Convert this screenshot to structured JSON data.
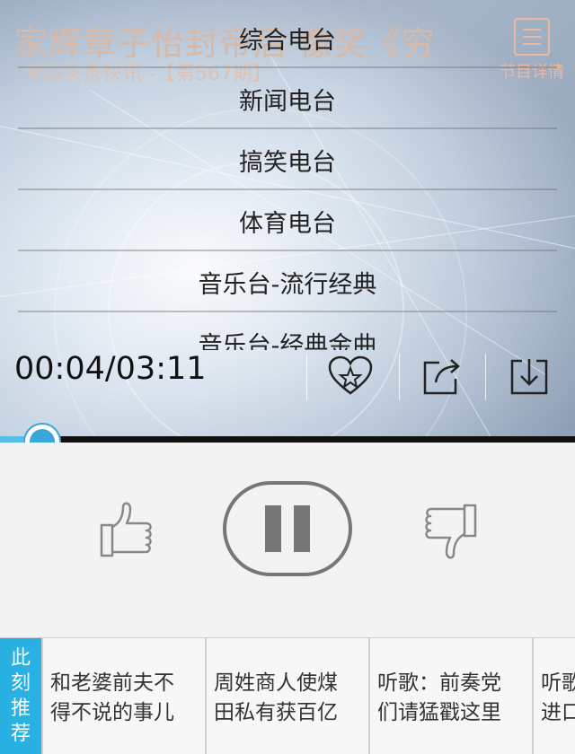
{
  "header": {
    "song_title": "家辉章子怡封帝后 像奖《穷",
    "song_subtitle": "考拉头条快讯 -【第567期】",
    "details_label": "节目详情"
  },
  "station_menu": {
    "items": [
      {
        "label": "综合电台"
      },
      {
        "label": "新闻电台"
      },
      {
        "label": "搞笑电台"
      },
      {
        "label": "体育电台"
      },
      {
        "label": "音乐台-流行经典"
      },
      {
        "label": "音乐台-经典金曲"
      }
    ]
  },
  "player": {
    "time": "00:04/03:11",
    "progress_fraction": 0.073,
    "actions": [
      {
        "icon": "favorite-star-heart-icon"
      },
      {
        "icon": "share-icon"
      },
      {
        "icon": "download-icon"
      }
    ],
    "controls": {
      "like_icon": "thumbs-up-icon",
      "pause_icon": "pause-icon",
      "dislike_icon": "thumbs-down-icon"
    }
  },
  "recommend": {
    "tag_chars": [
      "此",
      "刻",
      "推",
      "荐"
    ],
    "cards": [
      {
        "line1": "和老婆前夫不",
        "line2": "得不说的事儿"
      },
      {
        "line1": "周姓商人使煤",
        "line2": "田私有获百亿"
      },
      {
        "line1": "听歌：前奏党",
        "line2": "们请猛戳这里"
      },
      {
        "line1": "听歌",
        "line2": "进口"
      }
    ]
  },
  "colors": {
    "accent": "#2ab1e3",
    "progress_knob": "#3aa6d9",
    "title_faded": "#d7b9a6",
    "control_gray": "#777777"
  }
}
